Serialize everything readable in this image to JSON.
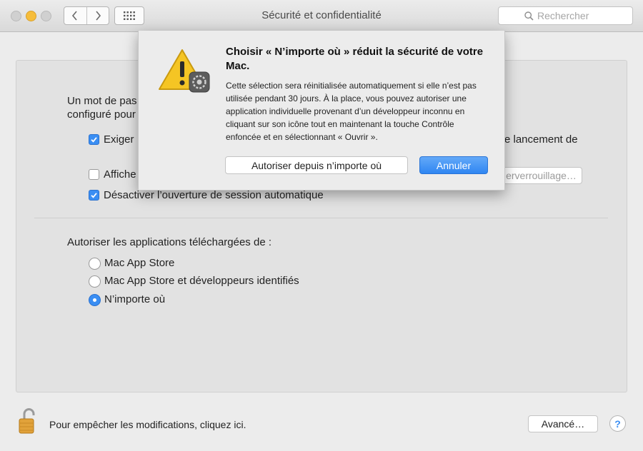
{
  "window": {
    "title": "Sécurité et confidentialité"
  },
  "toolbar": {
    "back_icon": "chevron-left-icon",
    "forward_icon": "chevron-right-icon",
    "grid_icon": "grid-icon",
    "search_placeholder": "Rechercher"
  },
  "general": {
    "password_line1": "Un mot de pas",
    "password_line2": "configuré pour",
    "require_label": "Exiger",
    "require_checked": true,
    "launch_fragment": "e lancement de",
    "show_label": "Affiche",
    "show_checked": false,
    "unlock_button": "erverrouillage…",
    "disable_autologin_label": "Désactiver l’ouverture de session automatique",
    "disable_autologin_checked": true
  },
  "downloads": {
    "heading": "Autoriser les applications téléchargées de :",
    "options": [
      {
        "label": "Mac App Store",
        "selected": false
      },
      {
        "label": "Mac App Store et développeurs identifiés",
        "selected": false
      },
      {
        "label": "N’importe où",
        "selected": true
      }
    ]
  },
  "sheet": {
    "icon": "warning-icon",
    "title": "Choisir « N’importe où » réduit la sécurité de votre Mac.",
    "body": "Cette sélection sera réinitialisée automatiquement si elle n’est pas utilisée pendant 30 jours. À la place, vous pouvez autoriser une application individuelle provenant d’un développeur inconnu en cliquant sur son icône tout en maintenant la touche Contrôle enfoncée et en sélectionnant « Ouvrir ».",
    "allow_button": "Autoriser depuis n’importe où",
    "cancel_button": "Annuler"
  },
  "footer": {
    "lock_text": "Pour empêcher les modifications, cliquez ici.",
    "advanced_button": "Avancé…",
    "help_label": "?"
  },
  "colors": {
    "accent": "#3a8ef3",
    "minimize": "#f6bd3b",
    "warning": "#f5c524"
  }
}
